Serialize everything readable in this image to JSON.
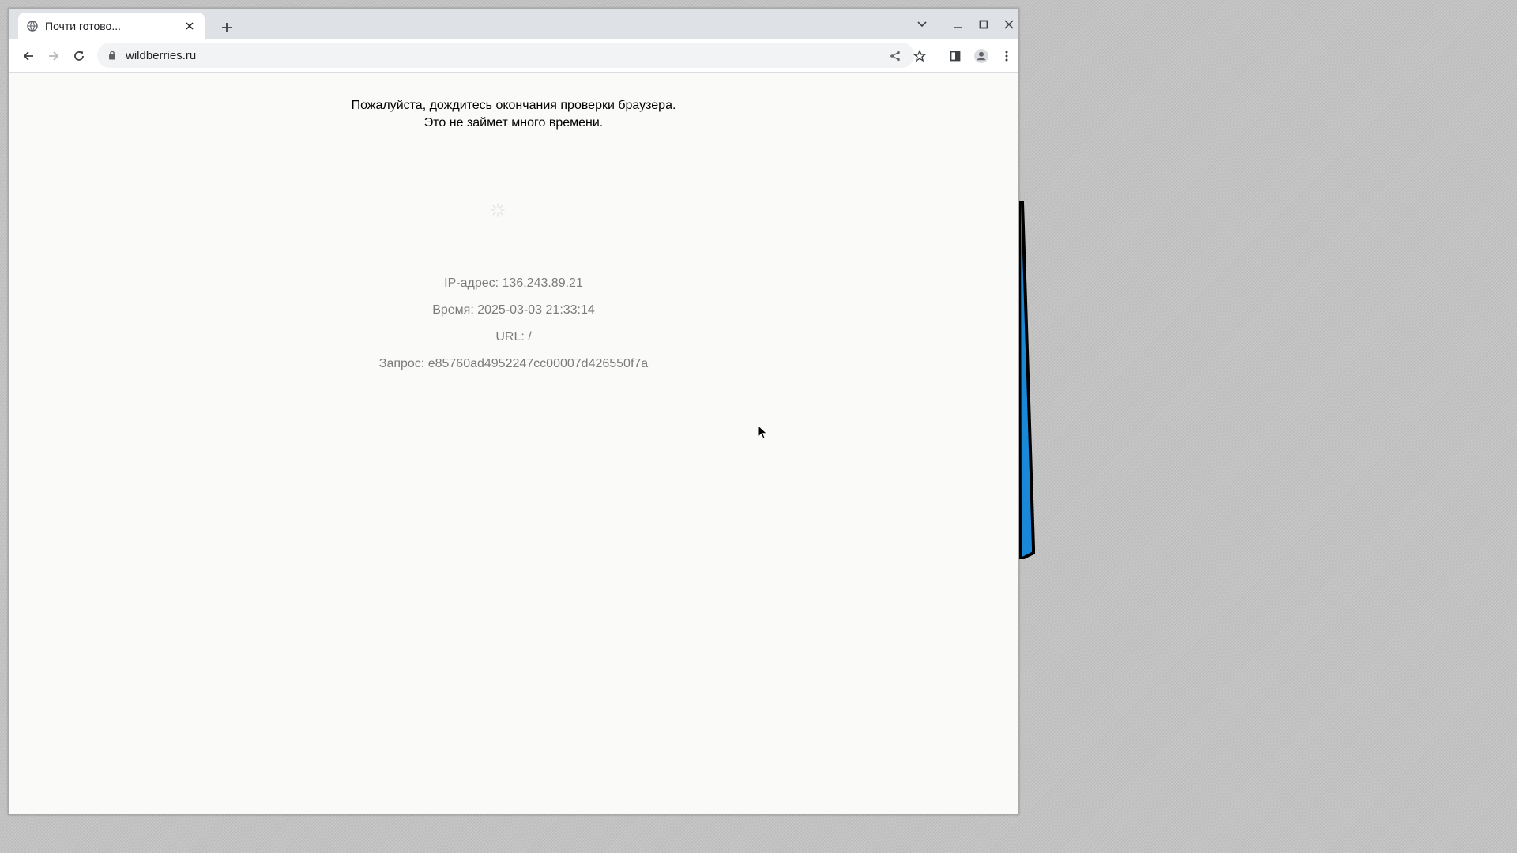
{
  "browser": {
    "tab": {
      "title": "Почти готово..."
    },
    "address_bar": {
      "url": "wildberries.ru"
    }
  },
  "page": {
    "message_line1": "Пожалуйста, дождитесь окончания проверки браузера.",
    "message_line2": "Это не займет много времени.",
    "info": {
      "ip": "IP-адрес: 136.243.89.21",
      "time": "Время: 2025-03-03 21:33:14",
      "url": "URL: /",
      "request": "Запрос: e85760ad4952247cc00007d426550f7a"
    }
  },
  "icons": [
    "globe-icon",
    "close-icon",
    "plus-icon",
    "chevron-down-icon",
    "minimize-icon",
    "maximize-icon",
    "back-arrow-icon",
    "forward-arrow-icon",
    "reload-icon",
    "lock-icon",
    "share-icon",
    "star-icon",
    "side-panel-icon",
    "profile-icon",
    "kebab-menu-icon",
    "spinner-icon",
    "mouse-cursor-icon"
  ],
  "colors": {
    "tabbar": "#dee1e6",
    "page_background": "#fafaf9",
    "info_text": "#7b7b7b",
    "desktop": "#c3c3c3",
    "background_shape": "#1a88d8"
  }
}
